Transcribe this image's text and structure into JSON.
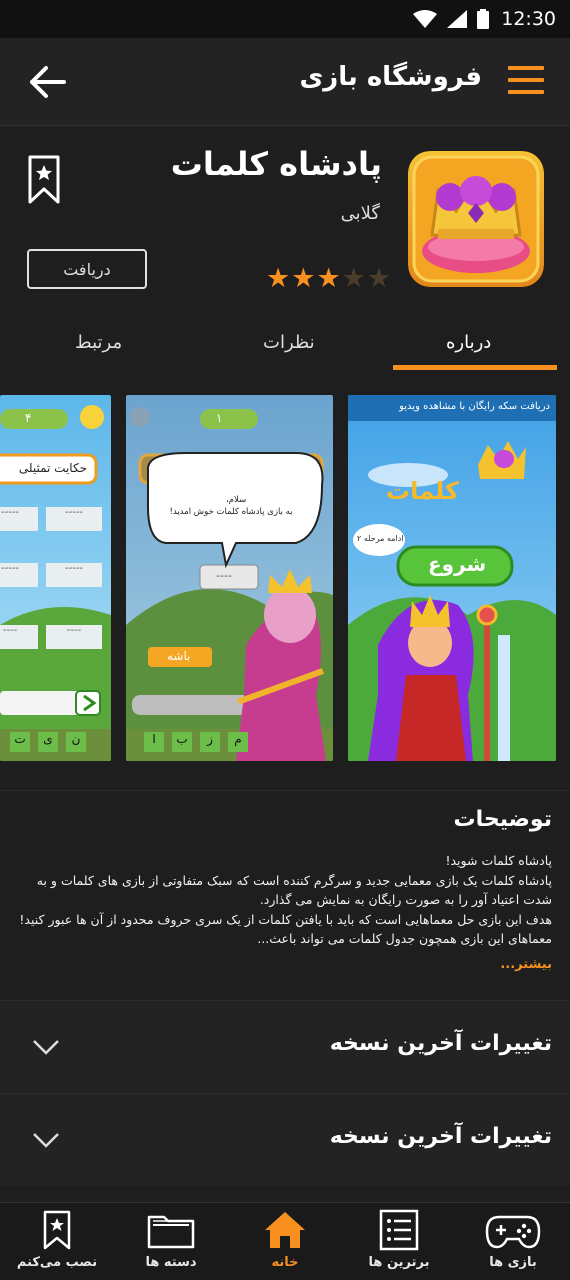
{
  "status": {
    "time": "12:30"
  },
  "appbar": {
    "title": "فروشگاه بازی",
    "back_icon": "arrow-left-icon",
    "menu_icon": "hamburger-menu-icon"
  },
  "app": {
    "title": "پادشاه کلمات",
    "developer": "گلابی",
    "rating": 3,
    "rating_max": 5,
    "get_label": "دریافت",
    "bookmark_icon": "bookmark-icon"
  },
  "tabs": [
    {
      "label": "درباره",
      "active": true
    },
    {
      "label": "نظرات",
      "active": false
    },
    {
      "label": "مرتبط",
      "active": false
    }
  ],
  "screenshots": {
    "shot1": {
      "banner": "دریافت سکه رایگان با مشاهده ویدیو",
      "logo": "کلمات",
      "start": "شروع",
      "bubble": "ادامه مرحله ۲"
    },
    "shot2": {
      "level": "۱",
      "greeting": "سلام،",
      "welcome": "به بازی پادشاه کلمات خوش امدید!",
      "blank": "----",
      "ok": "باشه",
      "letters": [
        "ا",
        "ب",
        "ز",
        "م"
      ]
    },
    "shot3": {
      "count": "۴",
      "story": "حکایت تمثیلی",
      "blanks": [
        "-----",
        "-----",
        "-----",
        "-----",
        "----",
        "----"
      ],
      "letters": [
        "ن",
        "ی",
        "ت"
      ]
    }
  },
  "description": {
    "title": "توضیحات",
    "lines": [
      "پادشاه کلمات شوید!",
      "پادشاه کلمات یک بازی معمایی جدید و سرگرم کننده است که سبک متفاوتی از بازی های کلمات و به شدت اعتیاد آور را به صورت رایگان به نمایش می گذارد.",
      "هدف این بازی حل معماهایی است که باید با یافتن کلمات از یک سری حروف محدود از آن ها عبور کنید!",
      "معماهای این بازی همچون جدول کلمات می تواند باعث..."
    ],
    "more": "بیشتر..."
  },
  "sections": [
    {
      "title": "تغییرات آخرین نسخه"
    },
    {
      "title": "تغییرات آخرین نسخه"
    }
  ],
  "bottom_nav": [
    {
      "label": "نصب می‌کنم",
      "icon": "bookmark-icon",
      "active": false
    },
    {
      "label": "دسته ها",
      "icon": "folder-icon",
      "active": false
    },
    {
      "label": "خانه",
      "icon": "home-icon",
      "active": true
    },
    {
      "label": "برترین ها",
      "icon": "list-icon",
      "active": false
    },
    {
      "label": "بازی ها",
      "icon": "gamepad-icon",
      "active": false
    }
  ],
  "colors": {
    "accent": "#f7901e",
    "background": "#1e1e1e",
    "appbar": "#232323"
  }
}
